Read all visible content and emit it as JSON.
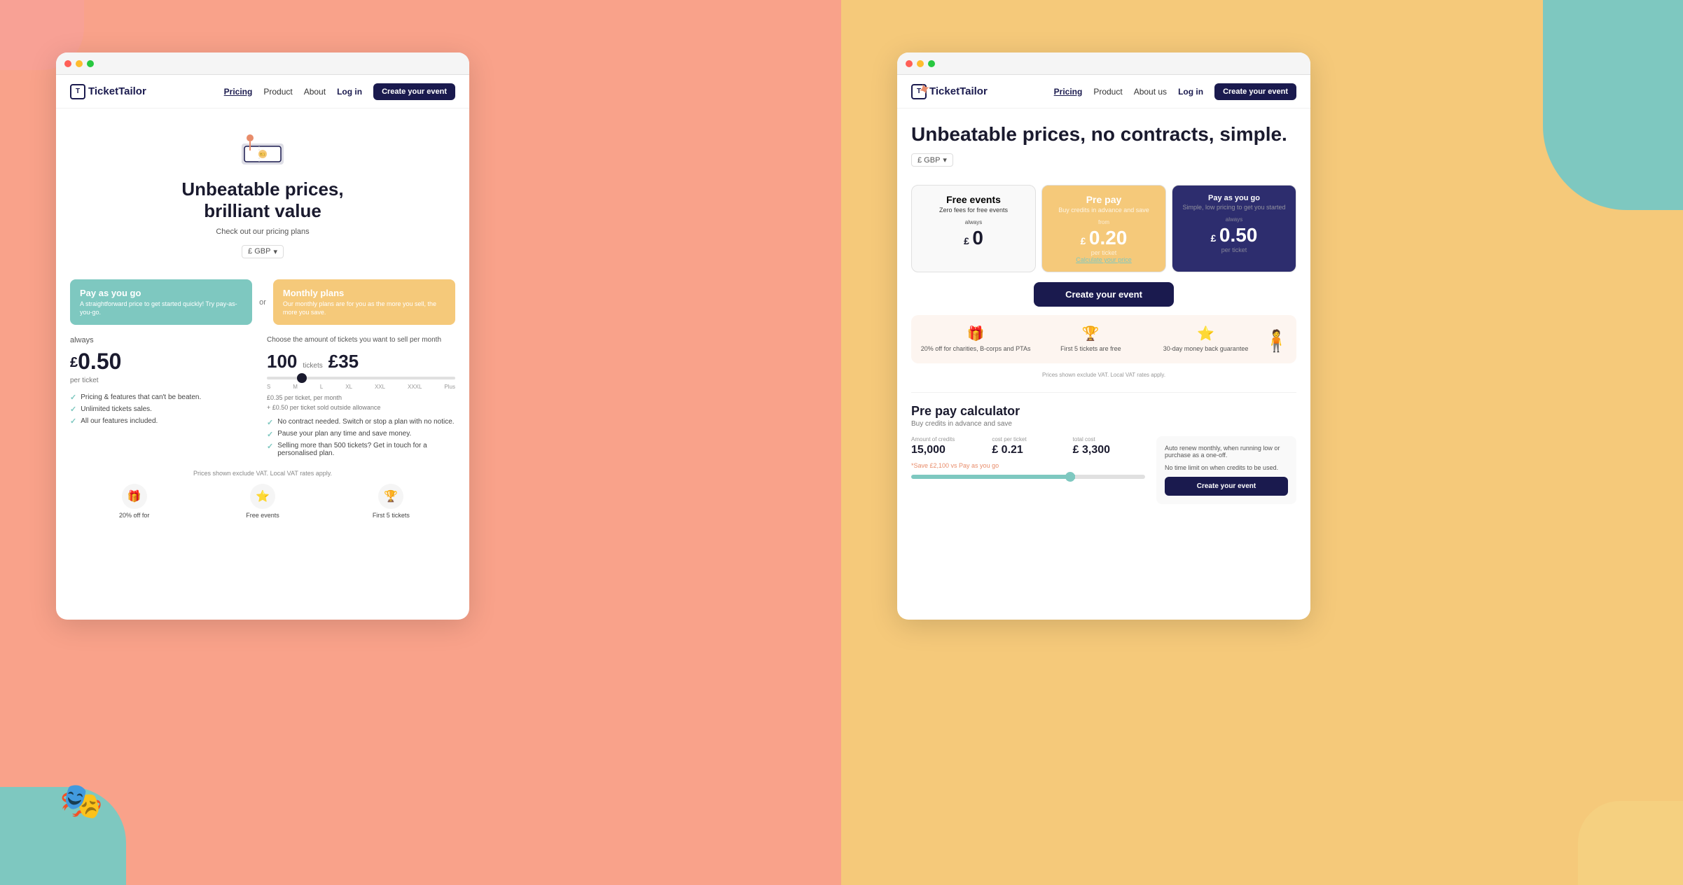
{
  "leftPage": {
    "nav": {
      "logo": "TicketTailor",
      "links": [
        {
          "label": "Pricing",
          "active": true
        },
        {
          "label": "Product",
          "active": false
        },
        {
          "label": "About",
          "active": false
        }
      ],
      "login": "Log in",
      "cta": "Create your event"
    },
    "hero": {
      "title_line1": "Unbeatable prices,",
      "title_line2": "brilliant value",
      "subtitle": "Check out our pricing plans",
      "currency": "£ GBP"
    },
    "payg": {
      "title": "Pay as you go",
      "desc": "A straightforward price to get started quickly! Try pay-as-you-go.",
      "price_label": "always",
      "price": "0.50",
      "price_unit": "per ticket",
      "features": [
        "Pricing & features that can't be beaten.",
        "Unlimited tickets sales.",
        "All our features included."
      ]
    },
    "monthly": {
      "title": "Monthly plans",
      "desc": "Our monthly plans are for you as the more you sell, the more you save.",
      "intro": "Choose the amount of tickets you want to sell per month",
      "tickets": "100",
      "tickets_label": "tickets",
      "price": "£35",
      "slider_labels": [
        "S",
        "M",
        "L",
        "XL",
        "XXL",
        "XXXL",
        "Plus"
      ],
      "pricing_note": "£0.35 per ticket, per month",
      "pricing_note2": "+ £0.50 per ticket sold outside allowance",
      "features": [
        "No contract needed. Switch or stop a plan with no notice.",
        "Pause your plan any time and save money.",
        "Selling more than 500 tickets? Get in touch for a personalised plan."
      ]
    },
    "bottom": {
      "note": "Prices shown exclude VAT. Local VAT rates apply.",
      "icons": [
        {
          "icon": "🎁",
          "label": "20% off for"
        },
        {
          "icon": "⭐",
          "label": "Free events"
        },
        {
          "icon": "🏆",
          "label": "First 5 tickets"
        }
      ]
    }
  },
  "rightPage": {
    "nav": {
      "logo": "TicketTailor",
      "links": [
        {
          "label": "Pricing",
          "active": true
        },
        {
          "label": "Product",
          "active": false
        },
        {
          "label": "About us",
          "active": false
        }
      ],
      "login": "Log in",
      "cta": "Create your event"
    },
    "hero": {
      "title": "Unbeatable prices, no contracts, simple.",
      "currency": "£ GBP"
    },
    "cards": [
      {
        "type": "free",
        "title": "Free events",
        "subtitle": "Zero fees for free events",
        "price_label": "always",
        "price": "0",
        "price_symbol": "£"
      },
      {
        "type": "prepay",
        "title": "Pre pay",
        "subtitle": "Buy credits in advance and save",
        "price_label": "from",
        "price": "0.20",
        "price_symbol": "£",
        "price_unit": "per ticket",
        "link": "Calculate your price"
      },
      {
        "type": "payg",
        "title": "Pay as you go",
        "subtitle": "Simple, low pricing to get you started",
        "price_label": "always",
        "price": "0.50",
        "price_symbol": "£",
        "price_unit": "per ticket"
      }
    ],
    "cta": "Create your event",
    "benefits": [
      {
        "icon": "🎁",
        "text": "20% off for charities, B-corps and PTAs"
      },
      {
        "icon": "🏆",
        "text": "First 5 tickets are free"
      },
      {
        "icon": "⭐",
        "text": "30-day money back guarantee"
      }
    ],
    "benefits_note": "Prices shown exclude VAT. Local VAT rates apply.",
    "calculator": {
      "title": "Pre pay calculator",
      "subtitle": "Buy credits in advance and save",
      "fields": [
        {
          "label": "Amount of credits",
          "value": "15,000"
        },
        {
          "label": "cost per ticket",
          "value": "£ 0.21"
        },
        {
          "label": "total cost",
          "value": "£ 3,300"
        }
      ],
      "save_note": "*Save £2,100 vs Pay as you go",
      "side_note1": "Auto renew monthly, when running low or purchase as a one-off.",
      "side_note2": "No time limit on when credits to be used.",
      "cta": "Create your event"
    }
  }
}
